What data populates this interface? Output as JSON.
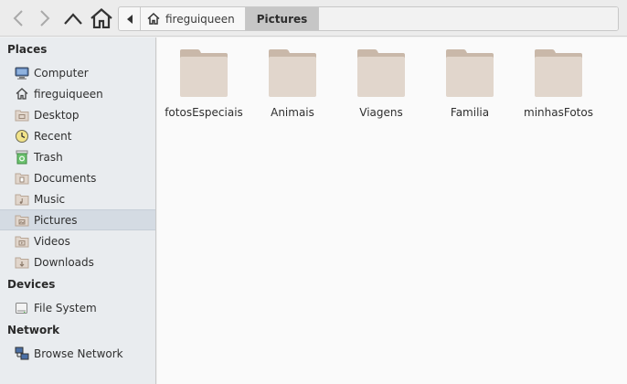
{
  "toolbar": {
    "back_icon": "chevron-left-icon",
    "forward_icon": "chevron-right-icon",
    "up_icon": "chevron-up-icon",
    "home_icon": "home-icon",
    "path": [
      {
        "label": "fireguiqueen",
        "icon": "home-icon"
      },
      {
        "label": "Pictures",
        "active": true
      }
    ]
  },
  "sidebar": {
    "places_title": "Places",
    "places": [
      {
        "label": "Computer",
        "icon": "computer-icon"
      },
      {
        "label": "fireguiqueen",
        "icon": "home-icon"
      },
      {
        "label": "Desktop",
        "icon": "desktop-folder-icon"
      },
      {
        "label": "Recent",
        "icon": "recent-icon"
      },
      {
        "label": "Trash",
        "icon": "trash-icon"
      },
      {
        "label": "Documents",
        "icon": "documents-folder-icon"
      },
      {
        "label": "Music",
        "icon": "music-folder-icon"
      },
      {
        "label": "Pictures",
        "icon": "pictures-folder-icon",
        "selected": true
      },
      {
        "label": "Videos",
        "icon": "videos-folder-icon"
      },
      {
        "label": "Downloads",
        "icon": "downloads-folder-icon"
      }
    ],
    "devices_title": "Devices",
    "devices": [
      {
        "label": "File System",
        "icon": "drive-icon"
      }
    ],
    "network_title": "Network",
    "network": [
      {
        "label": "Browse Network",
        "icon": "network-icon"
      }
    ]
  },
  "files": [
    {
      "name": "fotosEspeciais",
      "icon": "folder-icon"
    },
    {
      "name": "Animais",
      "icon": "folder-icon"
    },
    {
      "name": "Viagens",
      "icon": "folder-icon"
    },
    {
      "name": "Familia",
      "icon": "folder-icon"
    },
    {
      "name": "minhasFotos",
      "icon": "folder-icon"
    }
  ],
  "colors": {
    "folder_body": "#e1d6cc",
    "folder_tab": "#c9b8a9",
    "selection": "#d4dbe3"
  }
}
